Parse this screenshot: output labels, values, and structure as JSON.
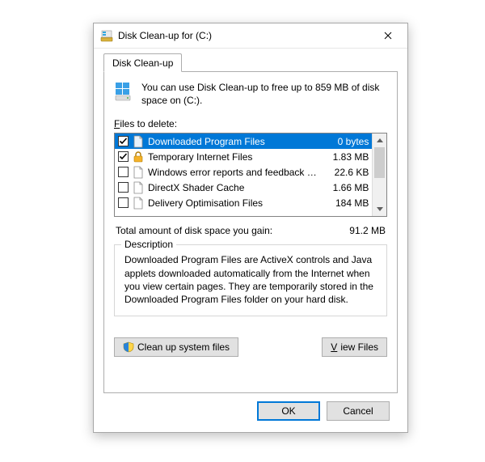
{
  "title": "Disk Clean-up for  (C:)",
  "tab_label": "Disk Clean-up",
  "intro": "You can use Disk Clean-up to free up to 859 MB of disk space on  (C:).",
  "files_label_pre": "F",
  "files_label_post": "iles to delete:",
  "items": [
    {
      "checked": true,
      "icon": "page-icon",
      "label": "Downloaded Program Files",
      "size": "0 bytes",
      "selected": true
    },
    {
      "checked": true,
      "icon": "lock-icon",
      "label": "Temporary Internet Files",
      "size": "1.83 MB",
      "selected": false
    },
    {
      "checked": false,
      "icon": "page-icon",
      "label": "Windows error reports and feedback di...",
      "size": "22.6 KB",
      "selected": false
    },
    {
      "checked": false,
      "icon": "page-icon",
      "label": "DirectX Shader Cache",
      "size": "1.66 MB",
      "selected": false
    },
    {
      "checked": false,
      "icon": "page-icon",
      "label": "Delivery Optimisation Files",
      "size": "184 MB",
      "selected": false
    }
  ],
  "total_label": "Total amount of disk space you gain:",
  "total_value": "91.2 MB",
  "description_legend": "Description",
  "description_body": "Downloaded Program Files are ActiveX controls and Java applets downloaded automatically from the Internet when you view certain pages. They are temporarily stored in the Downloaded Program Files folder on your hard disk.",
  "cleanup_system_label": "Clean up system files",
  "view_files_pre": "V",
  "view_files_post": "iew Files",
  "ok_label": "OK",
  "cancel_label": "Cancel"
}
